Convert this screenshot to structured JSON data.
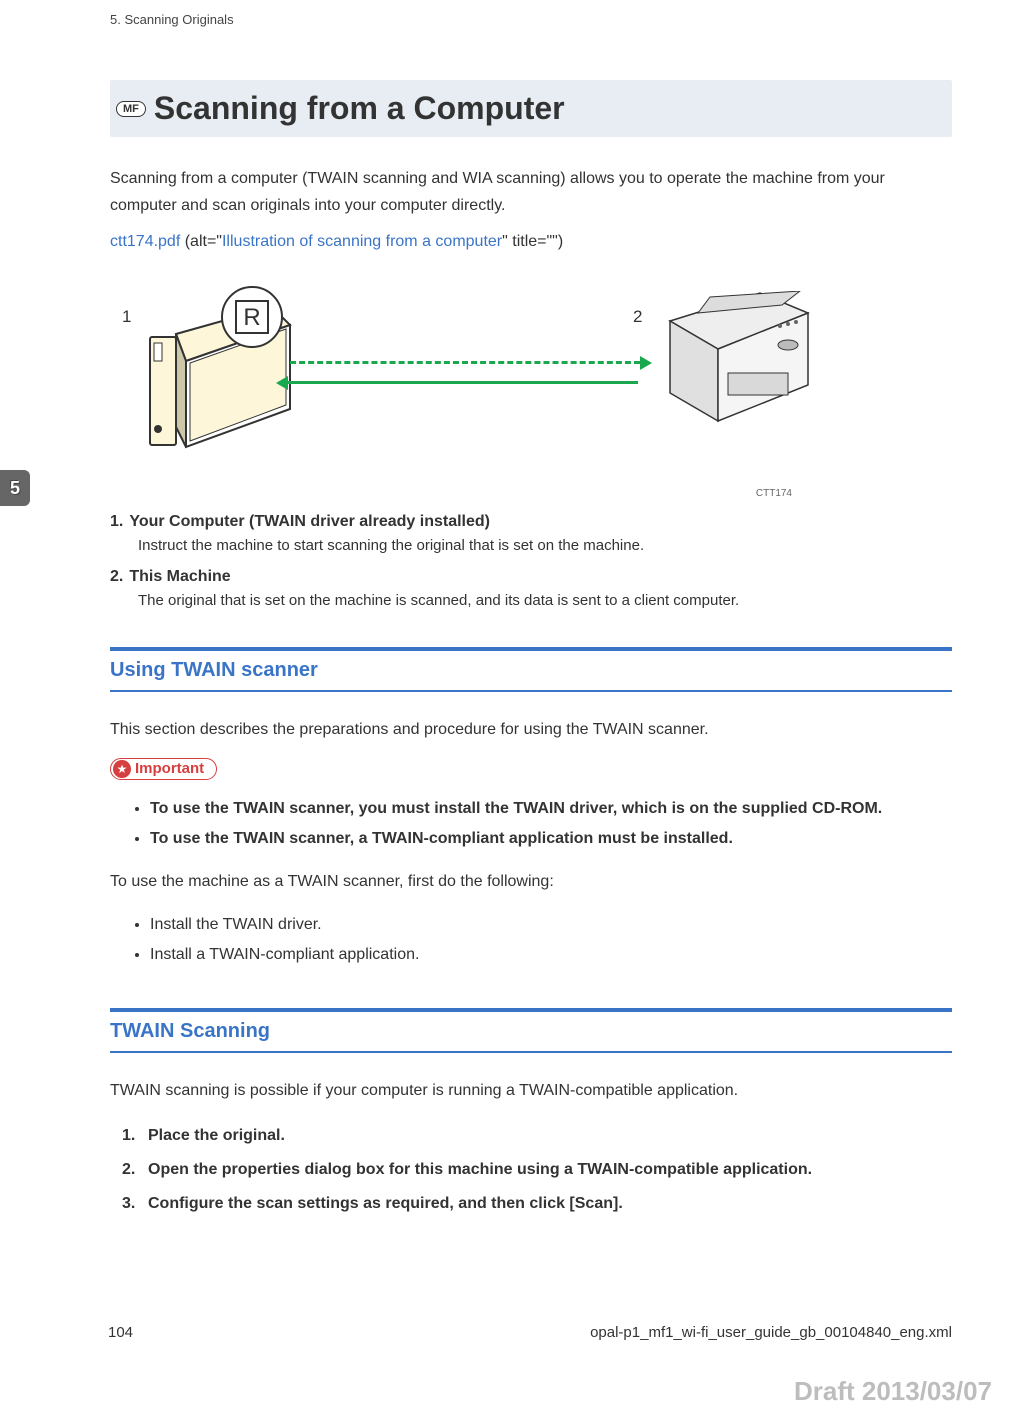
{
  "header": {
    "running": "5. Scanning Originals"
  },
  "badge": {
    "mf": "MF"
  },
  "title": "Scanning from a Computer",
  "intro": "Scanning from a computer (TWAIN scanning and WIA scanning) allows you to operate the machine from your computer and scan originals into your computer directly.",
  "link": {
    "file": "ctt174.pdf",
    "mid1": " (alt=\"",
    "alt": "Illustration of scanning from a computer",
    "mid2": "\" title=\"\")"
  },
  "illustration": {
    "label1": "1",
    "label2": "2",
    "caption": "CTT174"
  },
  "definitions": [
    {
      "num": "1.",
      "title": "Your Computer (TWAIN driver already installed)",
      "desc": "Instruct the machine to start scanning the original that is set on the machine."
    },
    {
      "num": "2.",
      "title": "This Machine",
      "desc": "The original that is set on the machine is scanned, and its data is sent to a client computer."
    }
  ],
  "section1": {
    "heading": "Using TWAIN scanner",
    "intro": "This section describes the preparations and procedure for using the TWAIN scanner.",
    "important_label": "Important",
    "important_bullets": [
      "To use the TWAIN scanner, you must install the TWAIN driver, which is on the supplied CD-ROM.",
      "To use the TWAIN scanner, a TWAIN-compliant application must be installed."
    ],
    "followup": "To use the machine as a TWAIN scanner, first do the following:",
    "steps": [
      "Install the TWAIN driver.",
      "Install a TWAIN-compliant application."
    ]
  },
  "section2": {
    "heading": "TWAIN Scanning",
    "intro": "TWAIN scanning is possible if your computer is running a TWAIN-compatible application.",
    "steps": [
      {
        "num": "1.",
        "text": "Place the original."
      },
      {
        "num": "2.",
        "text": "Open the properties dialog box for this machine using a TWAIN-compatible application."
      },
      {
        "num": "3.",
        "text": "Configure the scan settings as required, and then click [Scan]."
      }
    ]
  },
  "chapter_tab": "5",
  "footer": {
    "page": "104",
    "file": "opal-p1_mf1_wi-fi_user_guide_gb_00104840_eng.xml"
  },
  "draft": "Draft 2013/03/07"
}
